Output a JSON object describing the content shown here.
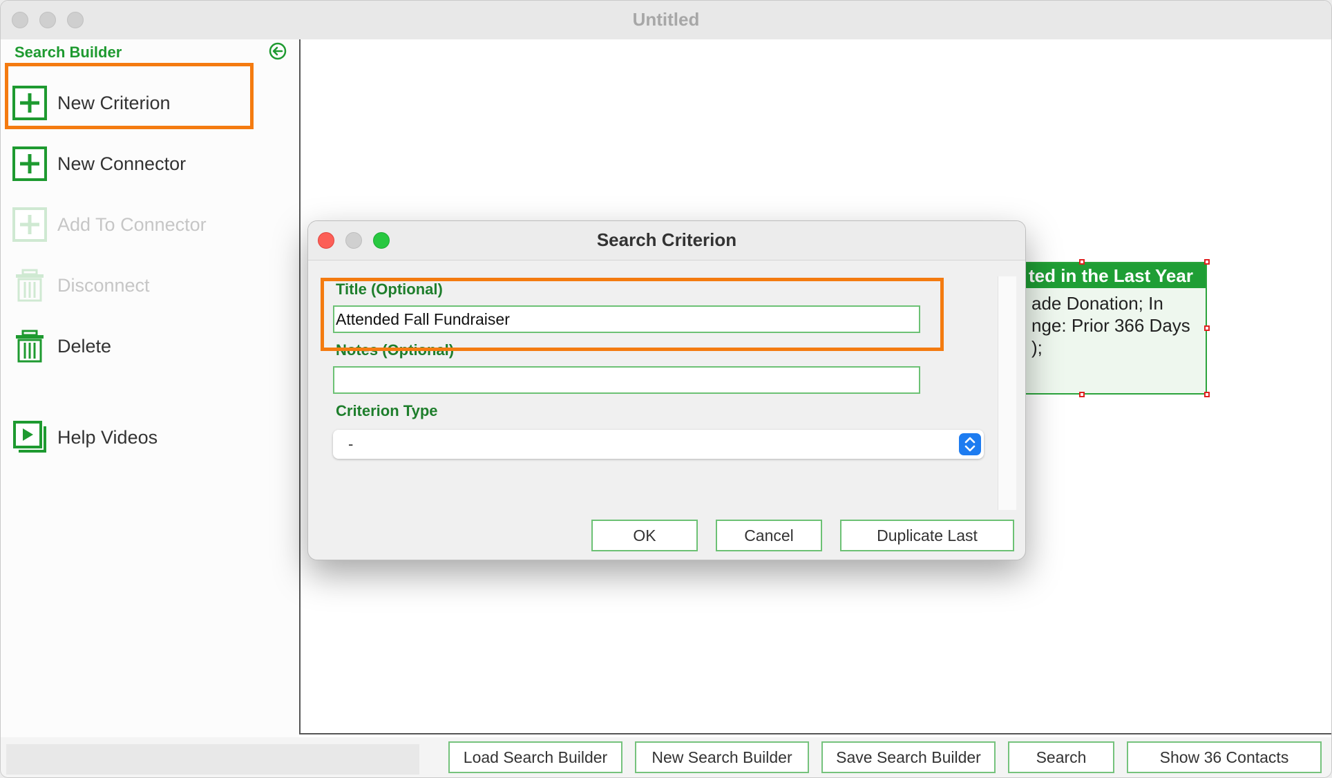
{
  "window": {
    "title": "Untitled"
  },
  "sidebar": {
    "title": "Search Builder",
    "collapse_icon": "collapse-left-icon",
    "items": [
      {
        "label": "New Criterion",
        "icon": "plus-square-icon",
        "enabled": true,
        "highlighted": true
      },
      {
        "label": "New Connector",
        "icon": "plus-square-icon",
        "enabled": true
      },
      {
        "label": "Add To Connector",
        "icon": "plus-square-icon",
        "enabled": false
      },
      {
        "label": "Disconnect",
        "icon": "trash-icon",
        "enabled": false
      },
      {
        "label": "Delete",
        "icon": "trash-icon",
        "enabled": true
      },
      {
        "label": "Help Videos",
        "icon": "video-icon",
        "enabled": true
      }
    ]
  },
  "canvas": {
    "node": {
      "header": "ted in the Last Year",
      "body": "ade Donation; In\nnge: Prior 366 Days\n);"
    }
  },
  "dialog": {
    "title": "Search Criterion",
    "title_label": "Title (Optional)",
    "title_value": "Attended Fall Fundraiser",
    "notes_label": "Notes (Optional)",
    "notes_value": "",
    "criterion_type_label": "Criterion Type",
    "criterion_type_value": "-",
    "buttons": {
      "ok": "OK",
      "cancel": "Cancel",
      "duplicate": "Duplicate Last"
    }
  },
  "bottom_bar": {
    "status": "",
    "buttons": {
      "load": "Load Search Builder",
      "new": "New Search Builder",
      "save": "Save Search Builder",
      "search": "Search",
      "show": "Show 36 Contacts"
    }
  },
  "colors": {
    "accent_green": "#1e9a30",
    "highlight_orange": "#f47b10",
    "close_red": "#fc5f57",
    "zoom_green": "#28c840"
  }
}
